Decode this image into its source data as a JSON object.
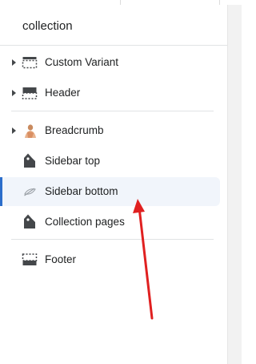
{
  "panel": {
    "title": "collection"
  },
  "items": [
    {
      "label": "Custom Variant",
      "icon": "section-dashed-icon",
      "expandable": true
    },
    {
      "label": "Header",
      "icon": "header-layout-icon",
      "expandable": true
    },
    {
      "label": "Breadcrumb",
      "icon": "breadcrumb-image-icon",
      "expandable": true
    },
    {
      "label": "Sidebar top",
      "icon": "tag-icon",
      "expandable": false
    },
    {
      "label": "Sidebar bottom",
      "icon": "eye-off-icon",
      "expandable": false,
      "selected": true
    },
    {
      "label": "Collection pages",
      "icon": "tag-icon",
      "expandable": false
    },
    {
      "label": "Footer",
      "icon": "footer-layout-icon",
      "expandable": false
    }
  ],
  "colors": {
    "selected_background": "#f1f5fb",
    "selected_indicator": "#2c6ecb",
    "annotation_arrow": "#e02020"
  }
}
